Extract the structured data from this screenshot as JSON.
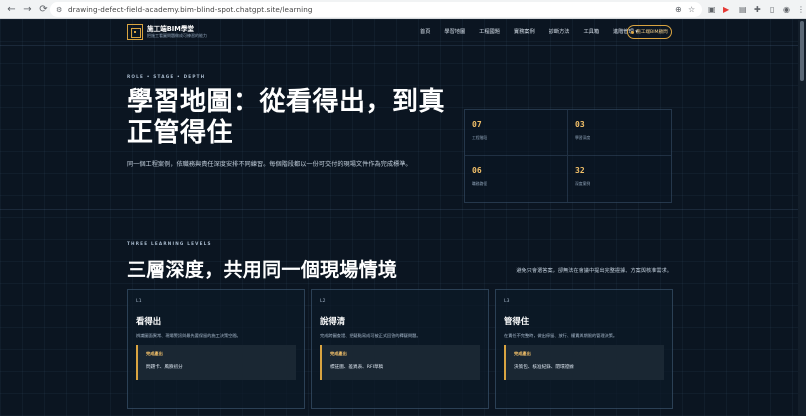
{
  "browser": {
    "url": "drawing-defect-field-academy.bim-blind-spot.chatgpt.site/learning",
    "back_icon": "back-arrow-icon",
    "forward_icon": "forward-arrow-icon",
    "reload_icon": "reload-icon"
  },
  "header": {
    "brand_title": "施工端BIM學堂",
    "brand_subtitle": "把施工看圖問題做成可練習的能力",
    "nav": [
      "首頁",
      "學習地圖",
      "工程國題",
      "實務案例",
      "診斷方法",
      "工具箱",
      "進階管理 ▾"
    ],
    "cta_label": "施工端BIM顧問"
  },
  "hero": {
    "kicker": "ROLE • STAGE • DEPTH",
    "title": "學習地圖：從看得出，到真正管得住",
    "description": "同一個工程案例，依職務與責任深度安排不同練習。每個階段都以一份可交付的現場文件作為完成標準。",
    "stats": [
      {
        "value": "07",
        "label": "工程階段"
      },
      {
        "value": "03",
        "label": "學習深度"
      },
      {
        "value": "06",
        "label": "職務路徑"
      },
      {
        "value": "32",
        "label": "深度案例"
      }
    ]
  },
  "levels": {
    "kicker": "THREE LEARNING LEVELS",
    "title": "三層深度，共用同一個現場情境",
    "aside": "避免只會選答案，卻無法在會議中提出完整證據、方案與核准需求。",
    "cards": [
      {
        "level": "L1",
        "title": "看得出",
        "desc": "辨識圖面異常、現場警訊與最先要保留的施工決策空間。",
        "deliverable_label": "完成產出",
        "deliverable": "問題卡、風險初分"
      },
      {
        "level": "L2",
        "title": "說得清",
        "desc": "完成跨圖查證、把疑點寫成可被正式回答的釋疑問題。",
        "deliverable_label": "完成產出",
        "deliverable": "標註圖、差異表、RFI草稿"
      },
      {
        "level": "L3",
        "title": "管得住",
        "desc": "在責任不完整時，做出停留、放行、權責與期限的管理決策。",
        "deliverable_label": "完成產出",
        "deliverable": "決策包、核准紀錄、閉環證據"
      }
    ]
  }
}
